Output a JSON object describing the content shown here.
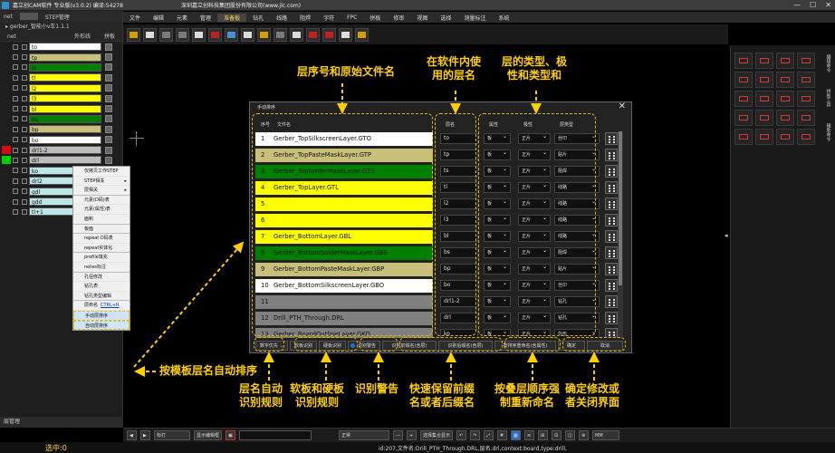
{
  "window": {
    "title": "嘉立创CAM软件 专业版(v3.0.2) 编译:54278",
    "company": "深圳嘉立创科技集团股份有限公司(www.jlc.com)",
    "min": "—",
    "max": "☐",
    "close": "✕"
  },
  "menu": [
    "文件",
    "编辑",
    "元素",
    "管理",
    "准备板",
    "钻孔",
    "线路",
    "阻焊",
    "字符",
    "FPC",
    "拼板",
    "修审",
    "视图",
    "选择",
    "测量标注",
    "系统"
  ],
  "menu_active_index": 4,
  "left_panel": {
    "tab_net": "net",
    "tab_step": "STEP管理",
    "job_name": "gerber_智能小v车1.1.1",
    "col_net": "net",
    "col_outline": "外形线",
    "col_panel": "拼板",
    "footer": "层管理",
    "layers": [
      {
        "name": "to",
        "color": "#ffffff"
      },
      {
        "name": "tp",
        "color": "#c8c07a"
      },
      {
        "name": "ts",
        "color": "#008000"
      },
      {
        "name": "tl",
        "color": "#ffff00"
      },
      {
        "name": "l2",
        "color": "#ffff00"
      },
      {
        "name": "l3",
        "color": "#ffff00"
      },
      {
        "name": "bl",
        "color": "#ffff00"
      },
      {
        "name": "bs",
        "color": "#008000"
      },
      {
        "name": "bp",
        "color": "#c8c07a"
      },
      {
        "name": "bo",
        "color": "#ffffff"
      },
      {
        "name": "drl1-2",
        "color": "#bdbdbd"
      },
      {
        "name": "drl",
        "color": "#bdbdbd"
      },
      {
        "name": "ko",
        "color": "#bde6e6"
      },
      {
        "name": "drl2",
        "color": "#bde6e6"
      },
      {
        "name": "gdl",
        "color": "#bde6e6"
      },
      {
        "name": "gdd",
        "color": "#bde6e6"
      },
      {
        "name": "tl+1",
        "color": "#bde6e6"
      }
    ],
    "marks": [
      "#d01010",
      "#00d000"
    ]
  },
  "context_menu": [
    {
      "label": "仅拷贝工作STEP",
      "arrow": ""
    },
    {
      "label": "STEP相关",
      "arrow": "▸"
    },
    {
      "label": "层相关",
      "arrow": "▸"
    },
    {
      "label": "元素(D码)表",
      "arrow": ""
    },
    {
      "label": "元素(属性)表",
      "arrow": ""
    },
    {
      "label": "面积",
      "arrow": ""
    },
    {
      "label": "板面",
      "arrow": ""
    },
    {
      "label": "repeat D码表",
      "arrow": ""
    },
    {
      "label": "repeat实体化",
      "arrow": ""
    },
    {
      "label": "profile填充",
      "arrow": ""
    },
    {
      "label": "notes标注",
      "arrow": ""
    },
    {
      "label": "孔径修改",
      "arrow": ""
    },
    {
      "label": "钻孔表",
      "arrow": ""
    },
    {
      "label": "钻孔类型编辑",
      "arrow": ""
    },
    {
      "label": "层命名",
      "arrow": "",
      "shortcut": "CTRL+R"
    },
    {
      "label": "手动层排序",
      "arrow": ""
    },
    {
      "label": "自动层排序",
      "arrow": ""
    }
  ],
  "dialog": {
    "title": "手动排序",
    "close": "✕",
    "headers": {
      "no": "序号",
      "file": "文件名",
      "layer": "层名",
      "attr": "属性",
      "polarity": "极性",
      "type": "层类型"
    },
    "rows": [
      {
        "no": "1",
        "file": "Gerber_TopSilkscreenLayer.GTO",
        "layer": "to",
        "attr": "板",
        "polarity": "正片",
        "type": "丝印",
        "color": "#ffffff"
      },
      {
        "no": "2",
        "file": "Gerber_TopPasteMaskLayer.GTP",
        "layer": "tp",
        "attr": "板",
        "polarity": "正片",
        "type": "贴片",
        "color": "#c8c07a"
      },
      {
        "no": "3",
        "file": "Gerber_TopSolderMaskLayer.GTS",
        "layer": "ts",
        "attr": "板",
        "polarity": "正片",
        "type": "阻焊",
        "color": "#008000"
      },
      {
        "no": "4",
        "file": "Gerber_TopLayer.GTL",
        "layer": "tl",
        "attr": "板",
        "polarity": "正片",
        "type": "线路",
        "color": "#ffff00"
      },
      {
        "no": "5",
        "file": "",
        "layer": "l2",
        "attr": "板",
        "polarity": "正片",
        "type": "线路",
        "color": "#ffff00"
      },
      {
        "no": "6",
        "file": "",
        "layer": "l3",
        "attr": "板",
        "polarity": "正片",
        "type": "线路",
        "color": "#ffff00"
      },
      {
        "no": "7",
        "file": "Gerber_BottomLayer.GBL",
        "layer": "bl",
        "attr": "板",
        "polarity": "正片",
        "type": "线路",
        "color": "#ffff00"
      },
      {
        "no": "8",
        "file": "Gerber_BottomSolderMaskLayer.GBS",
        "layer": "bs",
        "attr": "板",
        "polarity": "正片",
        "type": "阻焊",
        "color": "#008000"
      },
      {
        "no": "9",
        "file": "Gerber_BottomPasteMaskLayer.GBP",
        "layer": "bp",
        "attr": "板",
        "polarity": "正片",
        "type": "贴片",
        "color": "#c8c07a"
      },
      {
        "no": "10",
        "file": "Gerber_BottomSilkscreenLayer.GBO",
        "layer": "bo",
        "attr": "板",
        "polarity": "正片",
        "type": "丝印",
        "color": "#ffffff"
      },
      {
        "no": "11",
        "file": "",
        "layer": "drl1-2",
        "attr": "板",
        "polarity": "正片",
        "type": "钻孔",
        "color": "#808080"
      },
      {
        "no": "12",
        "file": "Drill_PTH_Through.DRL",
        "layer": "drl",
        "attr": "板",
        "polarity": "正片",
        "type": "钻孔",
        "color": "#808080"
      },
      {
        "no": "13",
        "file": "Gerber_BoardOutlineLayer.GKO",
        "layer": "ko",
        "attr": "板",
        "polarity": "正片",
        "type": "外形",
        "color": "#808080"
      }
    ],
    "buttons": [
      {
        "label": "数字优先",
        "arrow": "⌄"
      },
      {
        "label": "软板识别"
      },
      {
        "label": "硬板识别"
      },
      {
        "label": "识别警告",
        "warn": true
      },
      {
        "label": "识别前缀名(含层)"
      },
      {
        "label": "识别后缀名(含层)"
      },
      {
        "label": "按排序重命名(含属性)"
      },
      {
        "label": "确定"
      },
      {
        "label": "取消"
      }
    ]
  },
  "annotations": {
    "a1": "层序号和原始文件名",
    "a2": "在软件内使\n用的层名",
    "a3": "层的类型、极\n性和类型和",
    "a4": "按模板层名自动排序",
    "b1": "层名自动\n识别规则",
    "b2": "软板和硬板\n识别规则",
    "b3": "识别警告",
    "b4": "快速保留前缀\n名或者后缀名",
    "b5": "按叠层顺序强\n制重新命名",
    "b6": "确定修改或\n者关闭界面"
  },
  "right_panel": {
    "tabs": [
      "编辑命令",
      "拼板工具",
      "辅助命令"
    ]
  },
  "bottom_bar": {
    "mode": "标打",
    "show_btn": "显示编辑框",
    "sel_normal": "正常",
    "sel_all": "选择集合显示",
    "unit": "MM"
  },
  "status": {
    "selected": "选中:0",
    "info": "id:207,文件名:Drill_PTH_Through.DRL,层名:drl,context:board,type:drill,"
  }
}
